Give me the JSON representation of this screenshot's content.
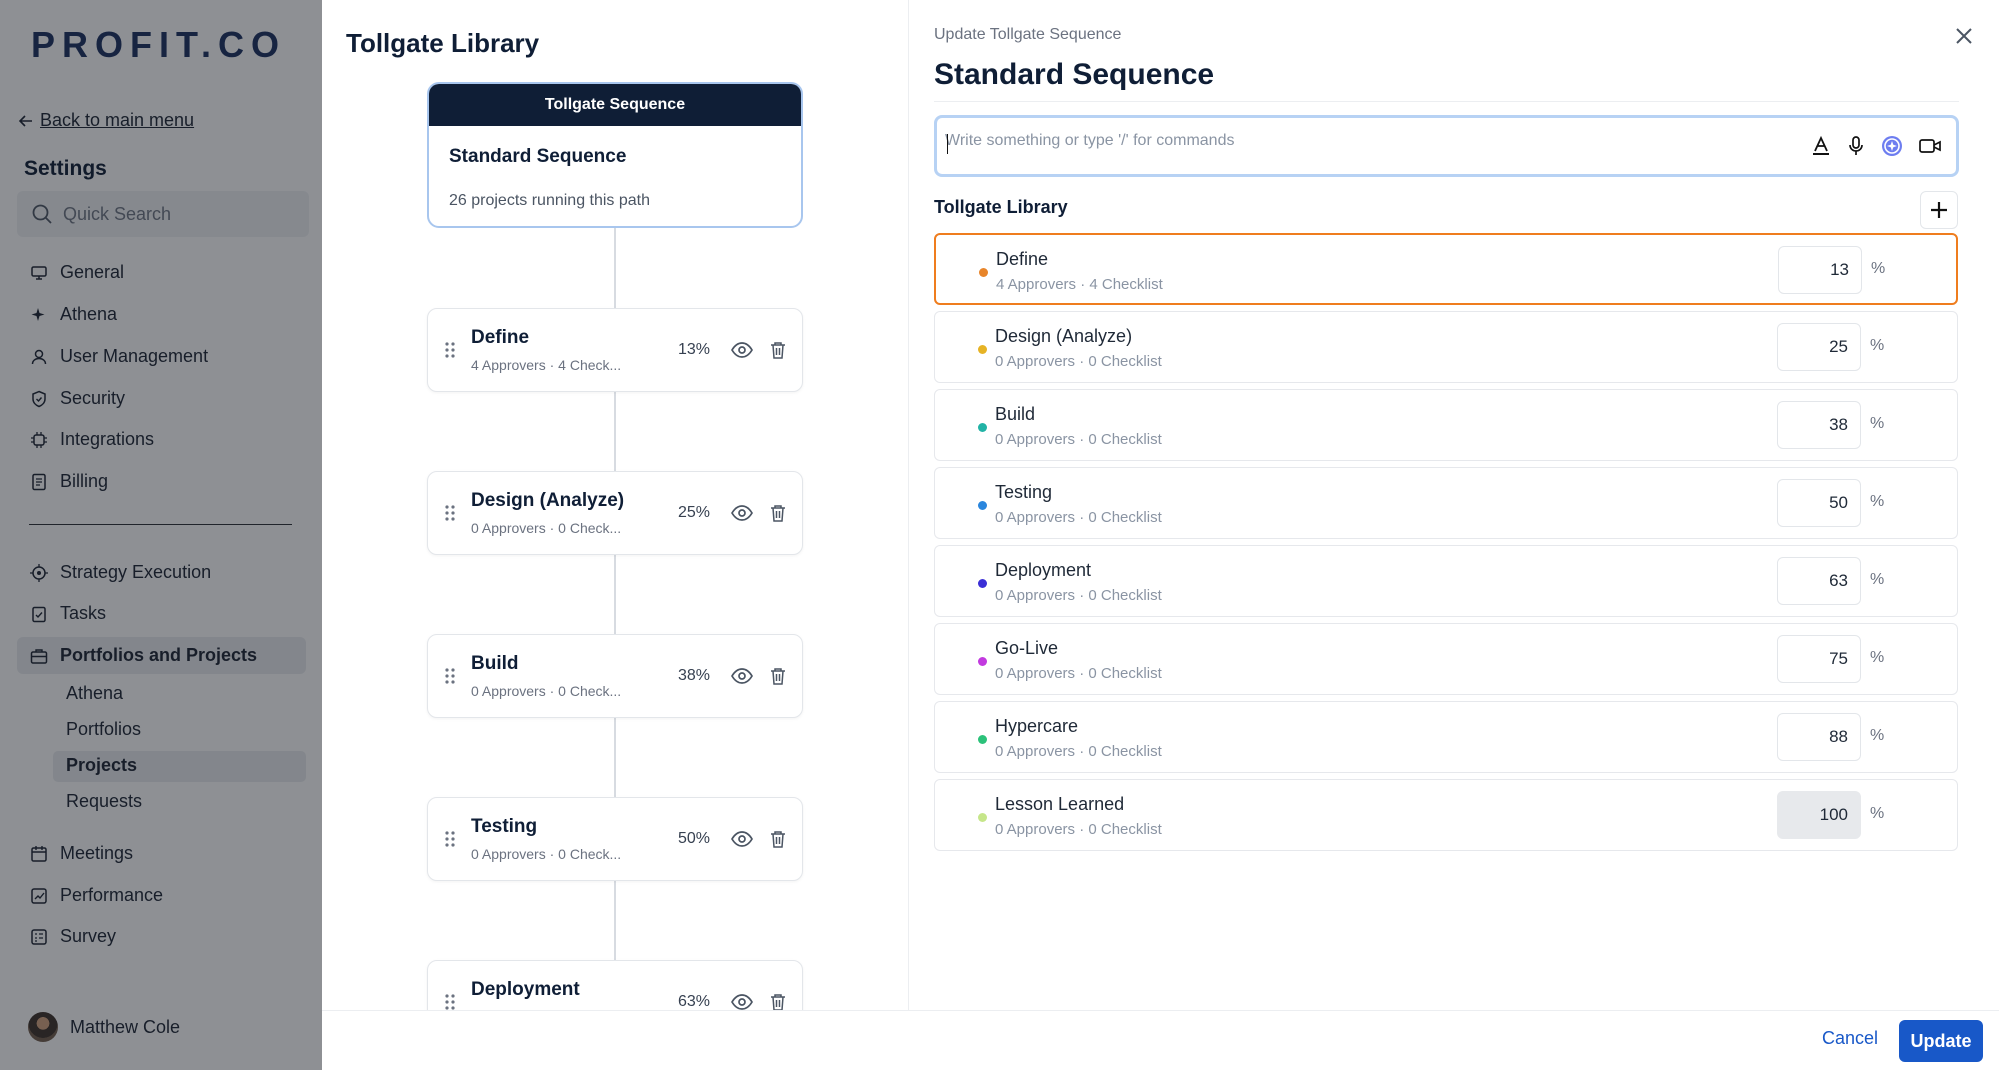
{
  "sidebar": {
    "logo": "PROFIT.CO",
    "back_label": "Back to main menu",
    "settings_title": "Settings",
    "search_placeholder": "Quick Search",
    "items_top": [
      {
        "label": "General",
        "icon": "monitor-icon"
      },
      {
        "label": "Athena",
        "icon": "sparkle-icon"
      },
      {
        "label": "User Management",
        "icon": "user-icon"
      },
      {
        "label": "Security",
        "icon": "shield-icon"
      },
      {
        "label": "Integrations",
        "icon": "plug-icon"
      },
      {
        "label": "Billing",
        "icon": "receipt-icon"
      }
    ],
    "items_bottom": [
      {
        "label": "Strategy Execution",
        "icon": "target-icon"
      },
      {
        "label": "Tasks",
        "icon": "clipboard-check-icon"
      },
      {
        "label": "Portfolios and Projects",
        "icon": "briefcase-icon"
      }
    ],
    "sub_items": [
      "Athena",
      "Portfolios",
      "Projects",
      "Requests"
    ],
    "items_after": [
      {
        "label": "Meetings",
        "icon": "calendar-icon"
      },
      {
        "label": "Performance",
        "icon": "chart-icon"
      },
      {
        "label": "Survey",
        "icon": "survey-icon"
      }
    ],
    "user_name": "Matthew Cole"
  },
  "library": {
    "title": "Tollgate Library",
    "sequence_header": "Tollgate Sequence",
    "sequence_name": "Standard Sequence",
    "sequence_sub": "26 projects running this path",
    "steps": [
      {
        "name": "Define",
        "meta": "4 Approvers · 4 Check...",
        "pct": "13%"
      },
      {
        "name": "Design (Analyze)",
        "meta": "0 Approvers · 0 Check...",
        "pct": "25%"
      },
      {
        "name": "Build",
        "meta": "0 Approvers · 0 Check...",
        "pct": "38%"
      },
      {
        "name": "Testing",
        "meta": "0 Approvers · 0 Check...",
        "pct": "50%"
      },
      {
        "name": "Deployment",
        "meta": "",
        "pct": "63%"
      }
    ]
  },
  "update_panel": {
    "label": "Update Tollgate Sequence",
    "title": "Standard Sequence",
    "editor_placeholder": "Write something or type '/' for commands",
    "library_title": "Tollgate Library",
    "unit": "%",
    "rows": [
      {
        "name": "Define",
        "meta": "4 Approvers · 4 Checklist",
        "value": "13",
        "color": "#e8852a"
      },
      {
        "name": "Design (Analyze)",
        "meta": "0 Approvers · 0 Checklist",
        "value": "25",
        "color": "#e6b325"
      },
      {
        "name": "Build",
        "meta": "0 Approvers · 0 Checklist",
        "value": "38",
        "color": "#22b3a6"
      },
      {
        "name": "Testing",
        "meta": "0 Approvers · 0 Checklist",
        "value": "50",
        "color": "#2a86dd"
      },
      {
        "name": "Deployment",
        "meta": "0 Approvers · 0 Checklist",
        "value": "63",
        "color": "#3b2fd6"
      },
      {
        "name": "Go-Live",
        "meta": "0 Approvers · 0 Checklist",
        "value": "75",
        "color": "#c23adf"
      },
      {
        "name": "Hypercare",
        "meta": "0 Approvers · 0 Checklist",
        "value": "88",
        "color": "#2cc27a"
      },
      {
        "name": "Lesson Learned",
        "meta": "0 Approvers · 0 Checklist",
        "value": "100",
        "color": "#c6e68a"
      }
    ],
    "cancel_label": "Cancel",
    "update_label": "Update"
  }
}
